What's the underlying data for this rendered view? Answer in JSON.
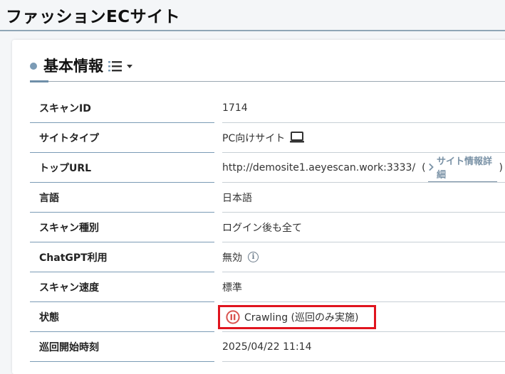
{
  "header": {
    "title": "ファッションECサイト"
  },
  "section": {
    "title": "基本情報"
  },
  "rows": [
    {
      "label": "スキャンID",
      "value": "1714"
    },
    {
      "label": "サイトタイプ",
      "value": "PC向けサイト"
    },
    {
      "label": "トップURL",
      "value": "http://demosite1.aeyescan.work:3333/",
      "link_label": "サイト情報詳細",
      "open_paren": "(",
      "close_paren": ")"
    },
    {
      "label": "言語",
      "value": "日本語"
    },
    {
      "label": "スキャン種別",
      "value": "ログイン後も全て"
    },
    {
      "label": "ChatGPT利用",
      "value": "無効"
    },
    {
      "label": "スキャン速度",
      "value": "標準"
    },
    {
      "label": "状態",
      "value": "Crawling (巡回のみ実施)"
    },
    {
      "label": "巡回開始時刻",
      "value": "2025/04/22 11:14"
    }
  ],
  "icons": {
    "site_type": "monitor-icon",
    "link": "chevron-right-icon",
    "chatgpt": "info-icon",
    "status": "pause-circle-icon",
    "section_menu": "list-icon"
  },
  "colors": {
    "accent": "#7b9bb5",
    "status_highlight": "#e0141e",
    "status_icon": "#d9534f",
    "link": "#7a92a6"
  }
}
